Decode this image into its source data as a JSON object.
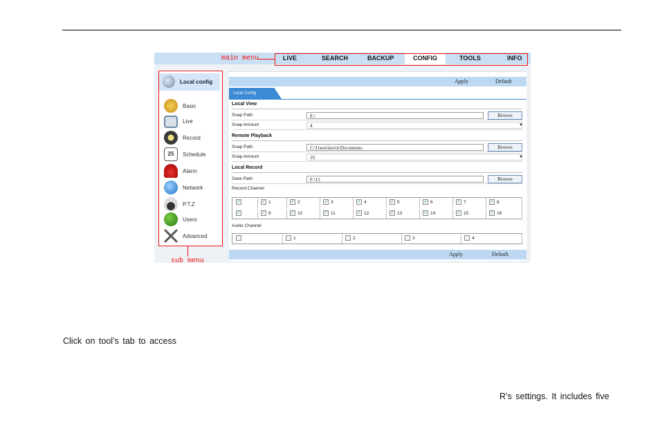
{
  "main_menu": {
    "items": [
      "LIVE",
      "SEARCH",
      "BACKUP",
      "CONFIG",
      "TOOLS",
      "INFO"
    ],
    "active": "CONFIG"
  },
  "callouts": {
    "main_menu": "main menu",
    "sub_menu": "sub menu"
  },
  "sidebar": {
    "header": "Local config",
    "items": [
      "Basic",
      "Live",
      "Record",
      "Schedule",
      "Alarm",
      "Network",
      "P.T.Z",
      "Users",
      "Advanced"
    ],
    "schedule_icon_text": "25"
  },
  "panel": {
    "apply": "Apply",
    "default": "Default",
    "tab": "Local Config",
    "local_view": {
      "title": "Local View",
      "snap_path_label": "Snap Path",
      "snap_path_value": "E:\\",
      "snap_amount_label": "Snap Amount",
      "snap_amount_value": "4"
    },
    "remote_playback": {
      "title": "Remote Playback",
      "snap_path_label": "Snap Path",
      "snap_path_value": "C:\\Users\\kevin\\Documents",
      "snap_amount_label": "Snap Amount",
      "snap_amount_value": "10"
    },
    "local_record": {
      "title": "Local Record",
      "save_path_label": "Save Path",
      "save_path_value": "F:\\15",
      "record_channel_label": "Record Channel",
      "audio_channel_label": "Audio Channel"
    },
    "browse": "Browse",
    "record_channels_row1": [
      "",
      "1",
      "2",
      "3",
      "4",
      "5",
      "6",
      "7",
      "8"
    ],
    "record_channels_row2": [
      "",
      "9",
      "10",
      "11",
      "12",
      "13",
      "14",
      "15",
      "16"
    ],
    "audio_channels": [
      "",
      "1",
      "2",
      "3",
      "4"
    ]
  },
  "body_text": {
    "line1": "Click on tool’s tab to access",
    "line2": "R’s settings. It includes five"
  }
}
